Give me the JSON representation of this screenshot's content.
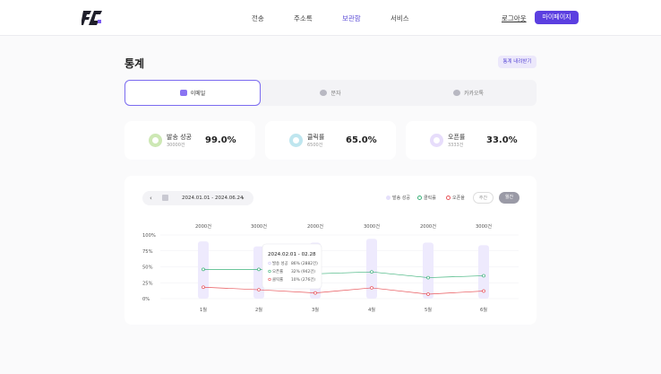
{
  "header": {
    "nav": [
      {
        "label": "전송",
        "active": false
      },
      {
        "label": "주소록",
        "active": false
      },
      {
        "label": "보관함",
        "active": true
      },
      {
        "label": "서비스",
        "active": false
      }
    ],
    "login_label": "로그아웃",
    "mypage_label": "마이페이지"
  },
  "page": {
    "title": "통계",
    "export_label": "통계 내려받기"
  },
  "tabs": [
    {
      "label": "이메일",
      "active": true
    },
    {
      "label": "문자",
      "active": false
    },
    {
      "label": "카카오톡",
      "active": false
    }
  ],
  "stats": [
    {
      "label": "발송 성공",
      "count": "30000건",
      "percent": "99.0%",
      "color": "#cde8b4"
    },
    {
      "label": "클릭률",
      "count": "6500건",
      "percent": "65.0%",
      "color": "#bfe6ef"
    },
    {
      "label": "오픈률",
      "count": "3333건",
      "percent": "33.0%",
      "color": "#e7ddfb"
    }
  ],
  "chart_controls": {
    "date_range": "2024.01.01 - 2024.06.24",
    "legend": [
      {
        "label": "발송 성공",
        "color": "#e5e0fb"
      },
      {
        "label": "클릭률",
        "color": "#3cb27a"
      },
      {
        "label": "오픈율",
        "color": "#e8555a"
      }
    ],
    "week_label": "주간",
    "month_label": "월간"
  },
  "tooltip": {
    "title": "2024.02.01 - 02.28",
    "rows": [
      {
        "label": "발송 성공",
        "value": "86% (2882건)",
        "color": "#cfc6f7"
      },
      {
        "label": "오픈률",
        "value": "32% (942건)",
        "color": "#3cb27a"
      },
      {
        "label": "클릭률",
        "value": "10% (276건)",
        "color": "#e8555a"
      }
    ]
  },
  "chart_data": {
    "type": "bar",
    "categories": [
      "1월",
      "2월",
      "3월",
      "4월",
      "5월",
      "6월"
    ],
    "bar_top_labels": [
      "2000건",
      "3000건",
      "2000건",
      "3000건",
      "2000건",
      "3000건"
    ],
    "y_ticks": [
      "100%",
      "75%",
      "50%",
      "25%",
      "0%"
    ],
    "ylim": [
      0,
      100
    ],
    "series": [
      {
        "name": "발송 성공",
        "kind": "bar",
        "color": "#eeeafd",
        "values": [
          90,
          82,
          88,
          94,
          88,
          84
        ]
      },
      {
        "name": "클릭률",
        "kind": "line",
        "color": "#3cb27a",
        "values": [
          46,
          46,
          39,
          42,
          33,
          36
        ]
      },
      {
        "name": "오픈율",
        "kind": "line",
        "color": "#e8555a",
        "values": [
          18,
          14,
          9,
          17,
          7,
          12
        ]
      }
    ],
    "grid": true
  }
}
